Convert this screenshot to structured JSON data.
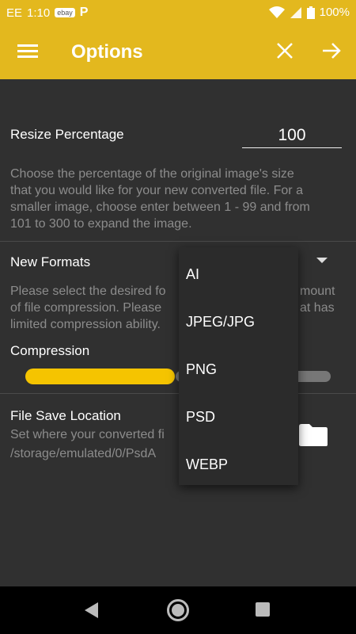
{
  "status_bar": {
    "carrier": "EE",
    "time": "1:10",
    "ebay_label": "ebay",
    "pay_label": "P",
    "battery": "100%",
    "icons": [
      "wifi-icon",
      "signal-icon",
      "battery-icon"
    ]
  },
  "app_bar": {
    "title": "Options",
    "icons": [
      "menu-icon",
      "close-icon",
      "arrow-forward-icon"
    ],
    "color": "#E3B81E"
  },
  "resize": {
    "label": "Resize Percentage",
    "value": "100",
    "description_lines": [
      "Choose the percentage of the original image's size",
      "that you would like for your new converted file. For a",
      "smaller image, choose enter between 1 - 99 and from",
      "101 to 300 to expand the image."
    ]
  },
  "formats": {
    "label": "New Formats",
    "description_lines": [
      "Please select the desired fo",
      "of file compression. Please",
      "limited compression ability."
    ],
    "description_right_fragments": [
      "mount",
      "at has"
    ],
    "options": [
      "AI",
      "JPEG/JPG",
      "PNG",
      "PSD",
      "WEBP"
    ]
  },
  "compression": {
    "label": "Compression",
    "level_fraction": 0.49,
    "accent": "#F5C400"
  },
  "file_save": {
    "label": "File Save Location",
    "description": "Set where your converted fi",
    "path": "/storage/emulated/0/PsdA",
    "icon": "folder-icon"
  },
  "nav_bar": {
    "icons": [
      "back-icon",
      "home-icon",
      "recents-icon"
    ]
  }
}
